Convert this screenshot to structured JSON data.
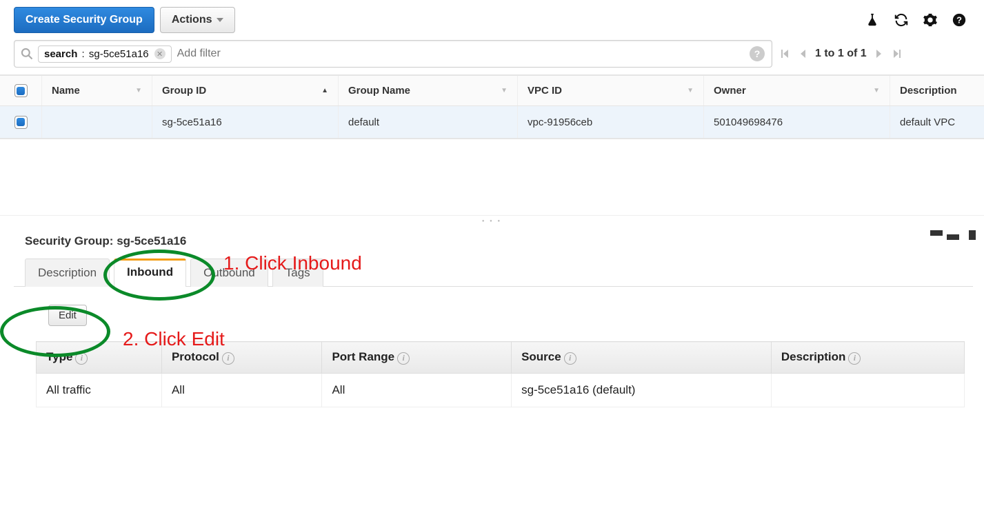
{
  "toolbar": {
    "create_label": "Create Security Group",
    "actions_label": "Actions"
  },
  "search": {
    "chip_key": "search",
    "chip_value": "sg-5ce51a16",
    "placeholder": "Add filter"
  },
  "pager": {
    "text": "1 to 1 of 1"
  },
  "grid": {
    "headers": {
      "name": "Name",
      "group_id": "Group ID",
      "group_name": "Group Name",
      "vpc_id": "VPC ID",
      "owner": "Owner",
      "description": "Description"
    },
    "row": {
      "name": "",
      "group_id": "sg-5ce51a16",
      "group_name": "default",
      "vpc_id": "vpc-91956ceb",
      "owner": "501049698476",
      "description": "default VPC"
    }
  },
  "detail": {
    "title_prefix": "Security Group:",
    "title_id": "sg-5ce51a16",
    "tabs": {
      "description": "Description",
      "inbound": "Inbound",
      "outbound": "Outbound",
      "tags": "Tags"
    },
    "edit_label": "Edit",
    "rule_headers": {
      "type": "Type",
      "protocol": "Protocol",
      "port_range": "Port Range",
      "source": "Source",
      "description": "Description"
    },
    "rule": {
      "type": "All traffic",
      "protocol": "All",
      "port_range": "All",
      "source": "sg-5ce51a16 (default)",
      "description": ""
    }
  },
  "annotations": {
    "step1": "1. Click Inbound",
    "step2": "2. Click Edit"
  }
}
